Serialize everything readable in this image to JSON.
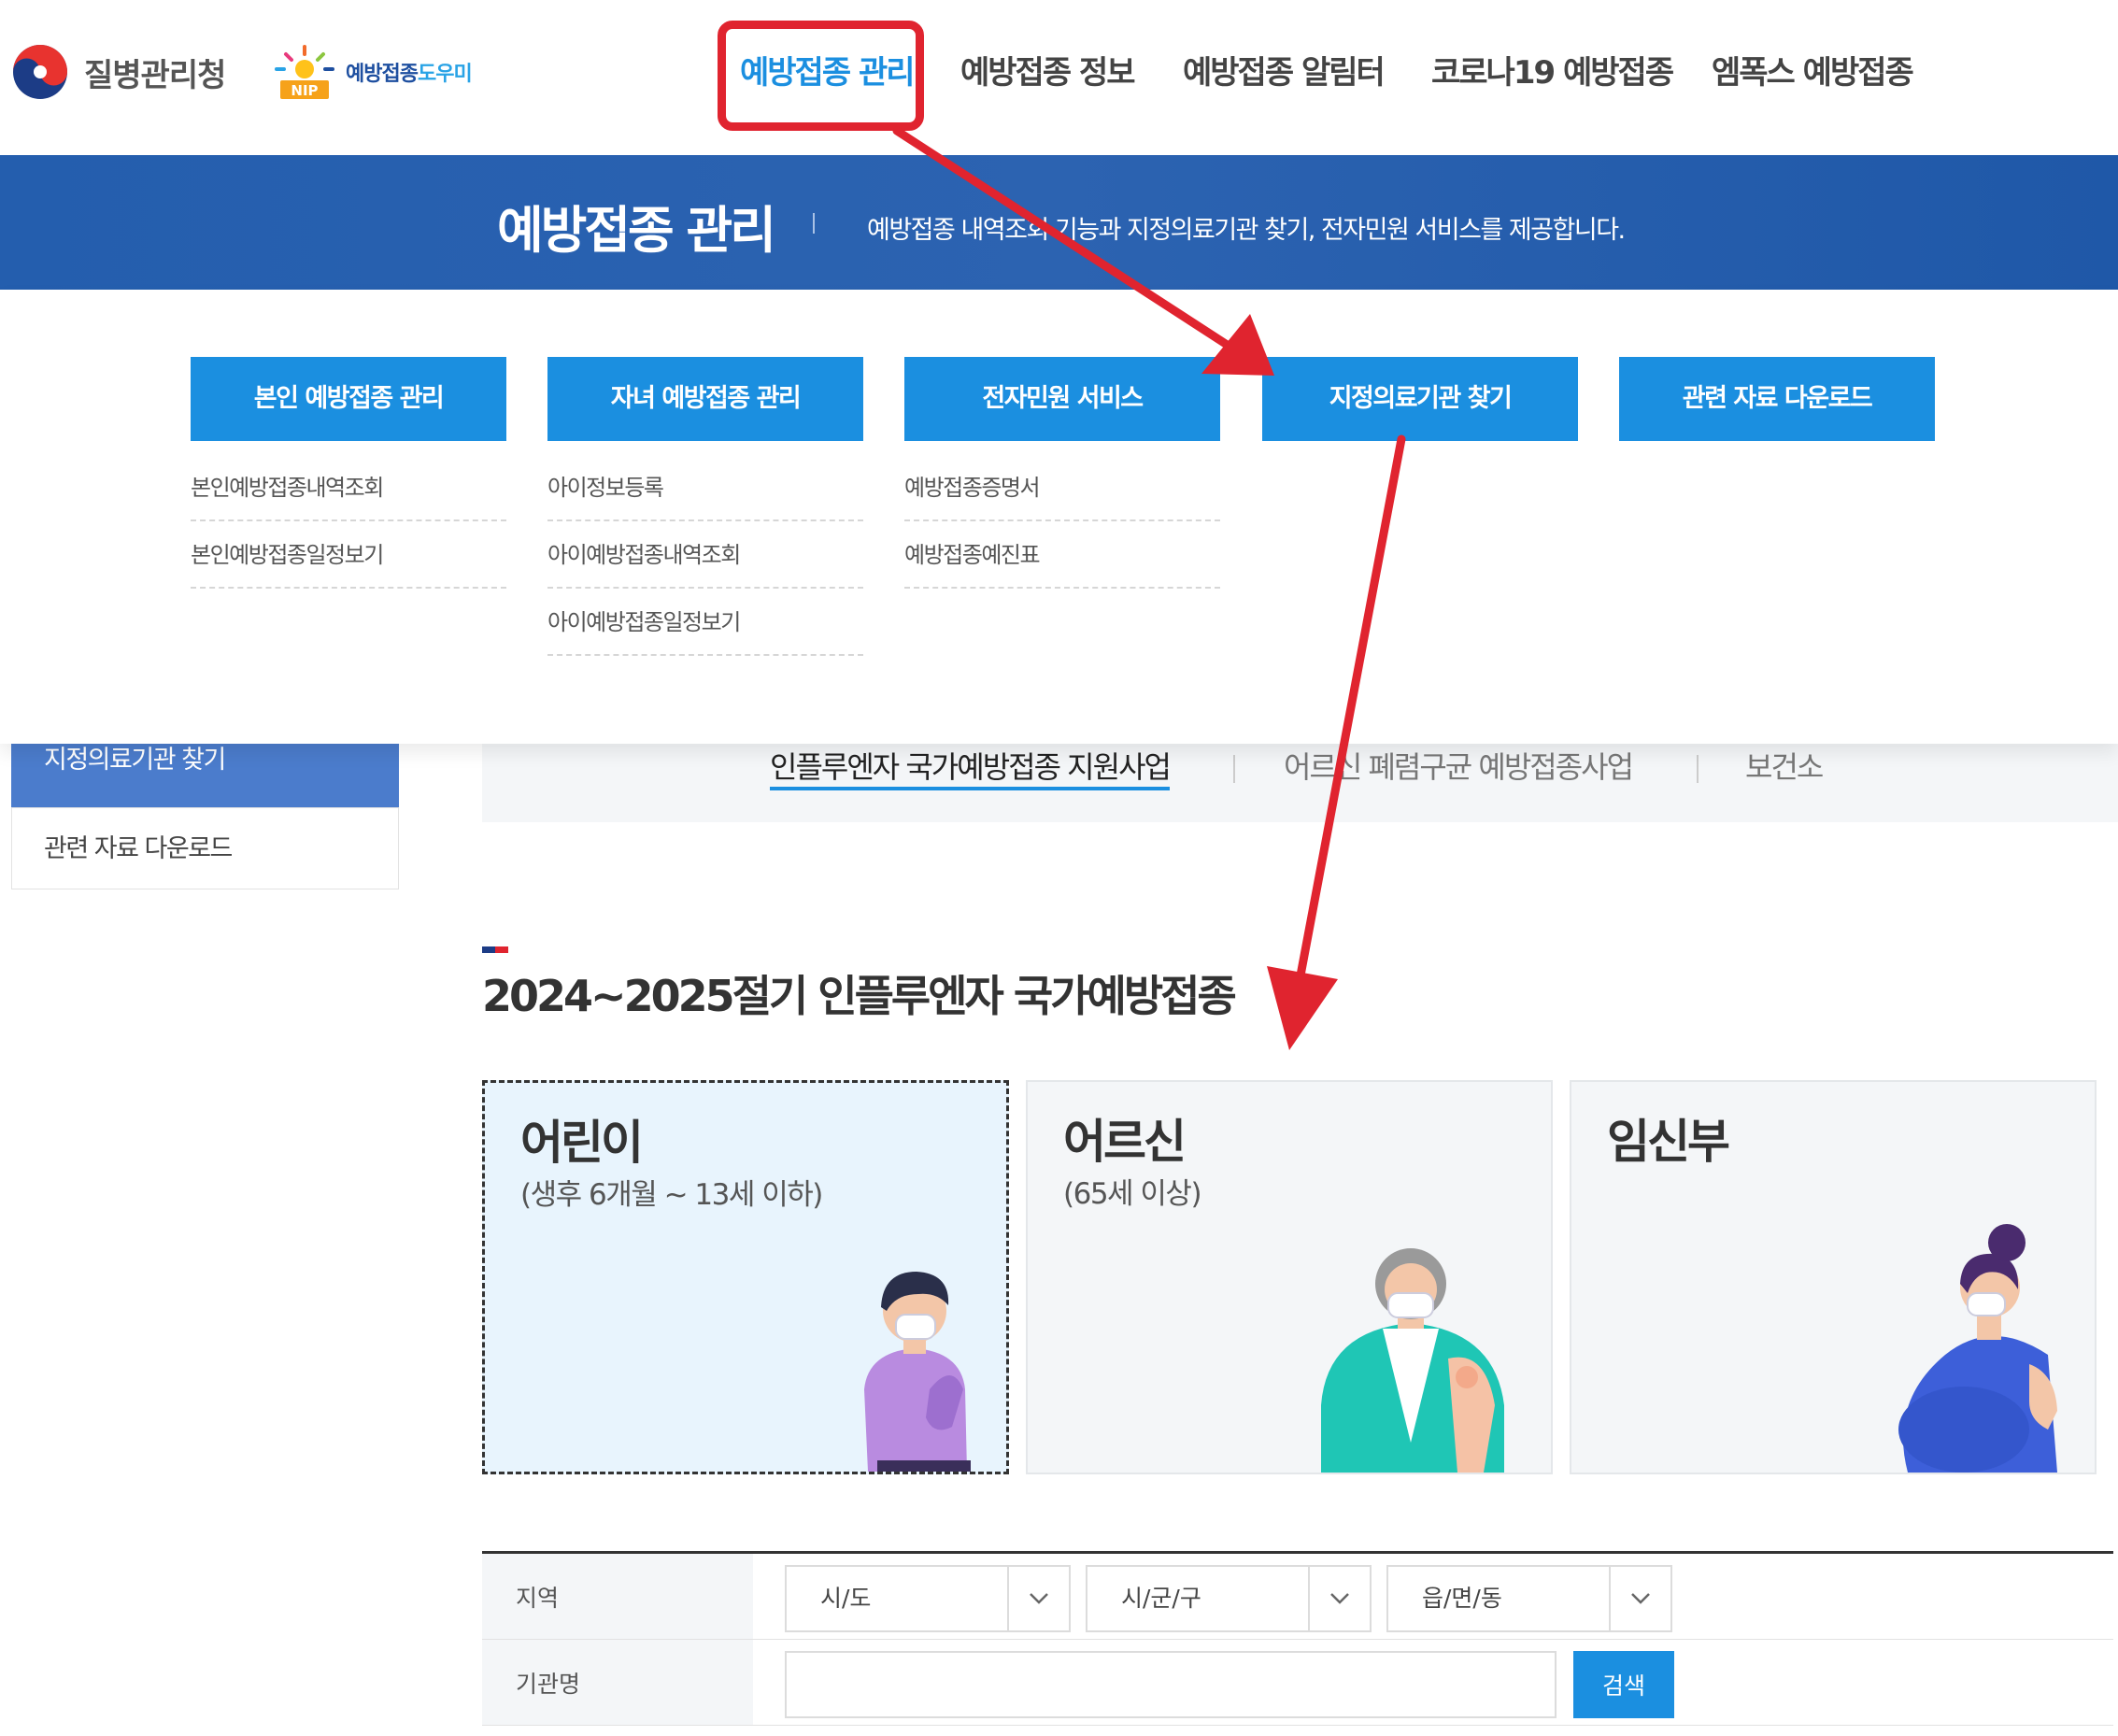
{
  "header": {
    "kdca_name": "질병관리청",
    "nip_name_a": "예방접종",
    "nip_name_b": "도우미",
    "nip_badge": "NIP",
    "gnb": [
      "예방접종 관리",
      "예방접종 정보",
      "예방접종 알림터",
      "코로나19 예방접종",
      "엠폭스 예방접종"
    ],
    "active_index": 0
  },
  "banner": {
    "title": "예방접종 관리",
    "description": "예방접종 내역조회 기능과 지정의료기관 찾기, 전자민원 서비스를 제공합니다."
  },
  "mega_menu": [
    {
      "label": "본인 예방접종 관리",
      "items": [
        "본인예방접종내역조회",
        "본인예방접종일정보기"
      ]
    },
    {
      "label": "자녀 예방접종 관리",
      "items": [
        "아이정보등록",
        "아이예방접종내역조회",
        "아이예방접종일정보기"
      ]
    },
    {
      "label": "전자민원 서비스",
      "items": [
        "예방접종증명서",
        "예방접종예진표"
      ]
    },
    {
      "label": "지정의료기관 찾기",
      "items": []
    },
    {
      "label": "관련 자료 다운로드",
      "items": []
    }
  ],
  "sidebar": {
    "active": "지정의료기관 찾기",
    "items": [
      "관련 자료 다운로드"
    ]
  },
  "tabs": [
    "인플루엔자 국가예방접종 지원사업",
    "어르신 폐렴구균 예방접종사업",
    "보건소"
  ],
  "active_tab": 0,
  "section_title": "2024~2025절기 인플루엔자 국가예방접종",
  "cards": [
    {
      "title": "어린이",
      "subtitle": "(생후 6개월 ~ 13세 이하)",
      "selected": true
    },
    {
      "title": "어르신",
      "subtitle": "(65세 이상)",
      "selected": false
    },
    {
      "title": "임신부",
      "subtitle": "",
      "selected": false
    }
  ],
  "search_form": {
    "region_label": "지역",
    "sido": "시/도",
    "sigungu": "시/군/구",
    "eupmyeondong": "읍/면/동",
    "inst_label": "기관명",
    "inst_value": "",
    "search_button": "검색"
  },
  "colors": {
    "accent": "#1b8fe0",
    "banner": "#2c63b1",
    "annotation": "#e0242f"
  }
}
